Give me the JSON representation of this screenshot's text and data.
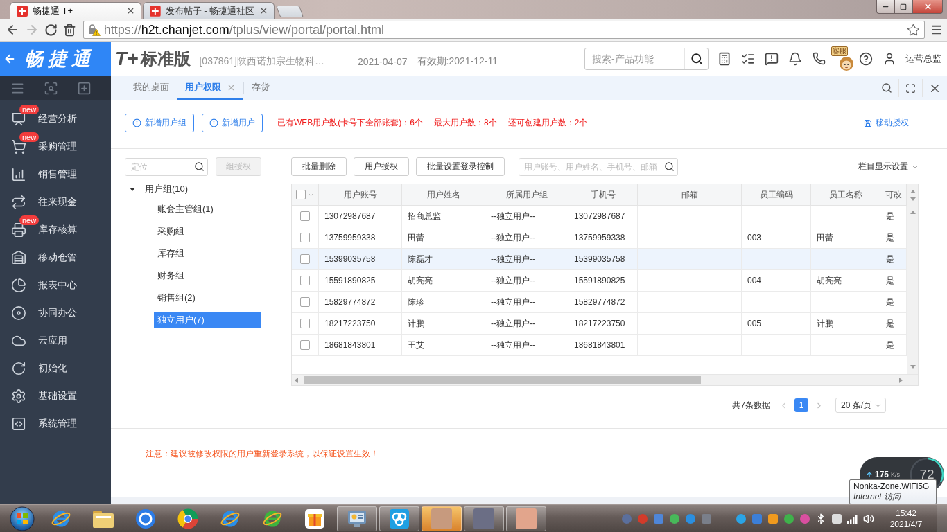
{
  "browser": {
    "tabs": [
      {
        "title": "畅捷通 T+",
        "selected": true
      },
      {
        "title": "发布帖子 - 畅捷通社区",
        "selected": false
      }
    ],
    "address": {
      "scheme": "https://",
      "host": "h2t.chanjet.com",
      "path": "/tplus/view/portal/portal.html"
    }
  },
  "header": {
    "logo": "畅捷通",
    "product_mark": "T+",
    "edition": "标准版",
    "company": "[037861]陕西诺加宗生物科…",
    "date": "2021-04-07",
    "validity": "有效期:2021-12-11",
    "search": {
      "placeholder": "搜索-产品功能"
    },
    "mascot_label": "客服",
    "user": "运营总监"
  },
  "sidebar": {
    "items": [
      {
        "label": "经营分析",
        "badge": "new"
      },
      {
        "label": "采购管理",
        "badge": "new"
      },
      {
        "label": "销售管理"
      },
      {
        "label": "往来现金"
      },
      {
        "label": "库存核算",
        "badge": "new"
      },
      {
        "label": "移动仓管"
      },
      {
        "label": "报表中心"
      },
      {
        "label": "协同办公"
      },
      {
        "label": "云应用"
      },
      {
        "label": "初始化"
      },
      {
        "label": "基础设置"
      },
      {
        "label": "系统管理"
      }
    ]
  },
  "tabs": [
    {
      "label": "我的桌面",
      "selected": false,
      "closable": false
    },
    {
      "label": "用户权限",
      "selected": true,
      "closable": true
    },
    {
      "label": "存货",
      "selected": false,
      "closable": false
    }
  ],
  "toolbar": {
    "buttons": [
      "新增用户组",
      "新增用户"
    ],
    "stats": [
      "已有WEB用户数(卡号下全部账套)：6个",
      "最大用户数：8个",
      "还可创建用户数：2个"
    ],
    "link": "移动授权"
  },
  "groups": {
    "search": {
      "placeholder": "定位"
    },
    "grant_button": {
      "label": "组授权",
      "disabled": true
    },
    "tree": [
      {
        "label": "用户组(10)",
        "expanded": true,
        "selected": false,
        "children": [
          {
            "label": "账套主管组(1)",
            "selected": false
          },
          {
            "label": "采购组",
            "selected": false
          },
          {
            "label": "库存组",
            "selected": false
          },
          {
            "label": "财务组",
            "selected": false
          },
          {
            "label": "销售组(2)",
            "selected": false
          },
          {
            "label": "独立用户(7)",
            "selected": true
          }
        ]
      }
    ]
  },
  "users": {
    "actions": [
      "批量删除",
      "用户授权",
      "批量设置登录控制"
    ],
    "search": {
      "placeholder": "用户账号、用户姓名、手机号、邮箱"
    },
    "column_settings": "栏目显示设置",
    "table": {
      "all_checked": false,
      "columns": [
        "用户账号",
        "用户姓名",
        "所属用户组",
        "手机号",
        "邮箱",
        "员工编码",
        "员工名称",
        "可改"
      ],
      "rows": [
        {
          "checked": false,
          "highlighted": false,
          "cells": [
            "13072987687",
            "招商总监",
            "--独立用户--",
            "13072987687",
            null,
            null,
            null,
            "是"
          ]
        },
        {
          "checked": false,
          "highlighted": false,
          "cells": [
            "13759959338",
            "田蕾",
            "--独立用户--",
            "13759959338",
            null,
            "003",
            "田蕾",
            "是"
          ]
        },
        {
          "checked": false,
          "highlighted": true,
          "cells": [
            "15399035758",
            "陈磊才",
            "--独立用户--",
            "15399035758",
            null,
            null,
            null,
            "是"
          ]
        },
        {
          "checked": false,
          "highlighted": false,
          "cells": [
            "15591890825",
            "胡亮亮",
            "--独立用户--",
            "15591890825",
            null,
            "004",
            "胡亮亮",
            "是"
          ]
        },
        {
          "checked": false,
          "highlighted": false,
          "cells": [
            "15829774872",
            "陈珍",
            "--独立用户--",
            "15829774872",
            null,
            null,
            null,
            "是"
          ]
        },
        {
          "checked": false,
          "highlighted": false,
          "cells": [
            "18217223750",
            "计鹏",
            "--独立用户--",
            "18217223750",
            null,
            "005",
            "计鹏",
            "是"
          ]
        },
        {
          "checked": false,
          "highlighted": false,
          "cells": [
            "18681843801",
            "王艾",
            "--独立用户--",
            "18681843801",
            null,
            null,
            null,
            "是"
          ]
        }
      ]
    },
    "pagination": {
      "total": "共7条数据",
      "pages": [
        {
          "label": "1",
          "selected": true
        }
      ],
      "page_size": "20 条/页"
    }
  },
  "notice": "注意：建议被修改权限的用户重新登录系统，以保证设置生效！",
  "network_monitor": {
    "speed": "175",
    "unit": "K/s",
    "value": "72"
  },
  "tooltip": {
    "network": "Nonka-Zone.WiFi5G",
    "status": "Internet 访问"
  },
  "taskbar": {
    "apps": [
      {
        "highlighted": false
      },
      {
        "highlighted": false
      },
      {
        "highlighted": true
      },
      {
        "highlighted": false
      },
      {
        "highlighted": false
      }
    ],
    "time": "15:42",
    "date": "2021/4/7"
  }
}
